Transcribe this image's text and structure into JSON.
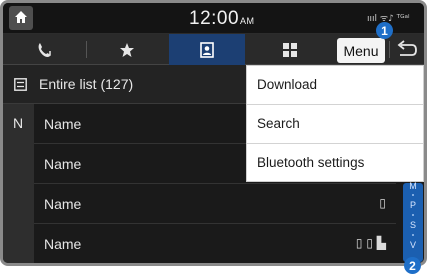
{
  "statusbar": {
    "time": "12:00",
    "ampm": "AM",
    "status_icons_text": "ıııl ᯤ♪ ᵀᴳᵃˡ"
  },
  "tabs": [
    {
      "icon": "recent-calls-icon",
      "active": false
    },
    {
      "icon": "favorites-star-icon",
      "active": false
    },
    {
      "icon": "contacts-icon",
      "active": true
    },
    {
      "icon": "keypad-icon",
      "active": false
    }
  ],
  "toolbar": {
    "menu_label": "Menu",
    "back_icon": "back-arrow-icon"
  },
  "callouts": {
    "first": "1",
    "second": "2"
  },
  "list": {
    "header_label": "Entire list (127)",
    "index_letter": "N",
    "rows": [
      {
        "name": "Name",
        "icons": ""
      },
      {
        "name": "Name",
        "icons": ""
      },
      {
        "name": "Name",
        "icons": "▯"
      },
      {
        "name": "Name",
        "icons": "▯ ▯ ▙"
      }
    ]
  },
  "menu": {
    "items": [
      {
        "label": "Download"
      },
      {
        "label": "Search"
      },
      {
        "label": "Bluetooth settings"
      }
    ]
  },
  "alpha_index": [
    "M",
    "P",
    "S",
    "V"
  ],
  "colors": {
    "active_tab": "#1c3f73",
    "callout_badge": "#1f6fc8",
    "index_bar": "#1b5fb0",
    "background": "#1a1a1a"
  }
}
